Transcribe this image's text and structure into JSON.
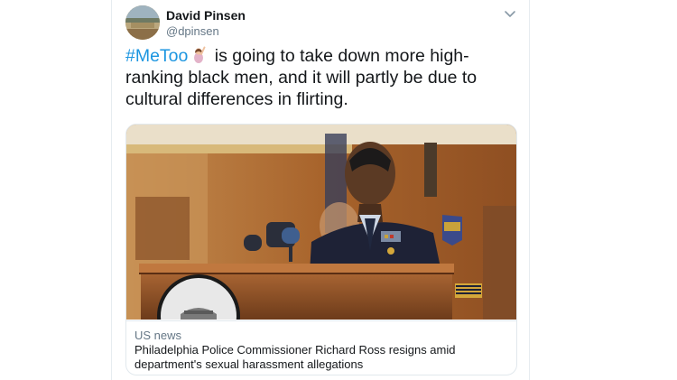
{
  "tweet": {
    "author_name": "David Pinsen",
    "author_handle": "@dpinsen",
    "hashtag": "#MeToo",
    "emoji": "woman-raising-hand-emoji",
    "body_line": "is going to take down more high-ranking black men, and it will partly be due to cultural differences in flirting."
  },
  "card": {
    "domain": "US news",
    "title": "Philadelphia Police Commissioner Richard Ross resigns amid department's sexual harassment allegations",
    "image_subject": "police-commissioner-at-podium-photo"
  },
  "colors": {
    "link": "#1b95e0",
    "secondary_text": "#657786",
    "border": "#e1e8ed"
  }
}
